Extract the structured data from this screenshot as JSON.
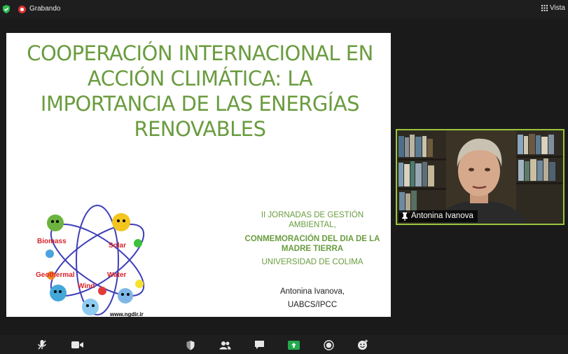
{
  "top_bar": {
    "recording_label": "Grabando",
    "view_label": "Vista"
  },
  "slide": {
    "title": "COOPERACIÓN INTERNACIONAL EN ACCIÓN CLIMÁTICA: LA IMPORTANCIA DE LAS ENERGÍAS RENOVABLES",
    "jornadas": "II JORNADAS DE GESTIÓN AMBIENTAL,",
    "conmemoracion": "CONMEMORACIÓN DEL DIA DE LA MADRE TIERRA",
    "universidad": "UNIVERSIDAD DE COLIMA",
    "author_name": "Antonina Ivanova,",
    "author_affiliation": "UABCS/IPCC",
    "logo": {
      "labels": [
        "Biomass",
        "Solar",
        "Geothermal",
        "Water",
        "Wind"
      ],
      "url": "www.ngdir.ir"
    }
  },
  "participant": {
    "name": "Antonina Ivanova"
  },
  "colors": {
    "title_green": "#6a9c3f",
    "video_border": "#9ac53b",
    "record_red": "#dd3333",
    "share_green": "#22a94d"
  },
  "toolbar_icons": [
    "mic-icon",
    "video-icon",
    "security-icon",
    "participants-icon",
    "chat-icon",
    "share-screen-icon",
    "record-icon",
    "reactions-icon"
  ]
}
